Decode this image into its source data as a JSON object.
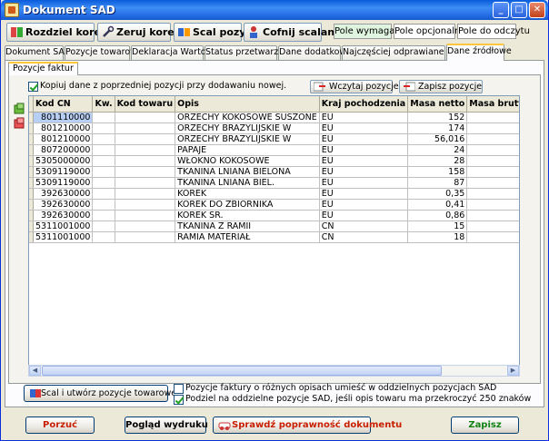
{
  "window": {
    "title": "Dokument SAD"
  },
  "toolbar": {
    "buttons": [
      {
        "label": "Rozdziel korektę",
        "icon": "split-icon"
      },
      {
        "label": "Zeruj korekty",
        "icon": "wrench-icon"
      },
      {
        "label": "Scal pozycje",
        "icon": "merge-icon"
      },
      {
        "label": "Cofnij scalanie",
        "icon": "undo-merge-icon"
      }
    ],
    "legend": {
      "required": "Pole wymagane",
      "optional": "Pole opcjonalne",
      "readonly": "Pole do odczytu"
    }
  },
  "colors": {
    "required": "#dff5df",
    "optional": "#ffffff",
    "readonly": "#ffffff",
    "accent": "#ffc83c"
  },
  "tabs": [
    {
      "label": "Dokument SAD"
    },
    {
      "label": "Pozycje towarowe"
    },
    {
      "label": "Deklaracja Wartości"
    },
    {
      "label": "Status przetwarzania"
    },
    {
      "label": "Dane dodatkowe"
    },
    {
      "label": "Najczęściej odprawiane towary"
    },
    {
      "label": "Dane źródłowe"
    }
  ],
  "subtab": {
    "label": "Pozycje faktur"
  },
  "copy_checkbox": {
    "label": "Kopiuj dane z poprzedniej pozycji przy dodawaniu nowej.",
    "checked": true
  },
  "actions": {
    "load": "Wczytaj pozycje",
    "save": "Zapisz pozycje"
  },
  "grid": {
    "columns": [
      "Kod CN",
      "Kw.",
      "Kod towaru",
      "Opis",
      "Kraj pochodzenia",
      "Masa netto",
      "Masa brutto"
    ],
    "rows": [
      [
        "801110000",
        "",
        "",
        "ORZECHY KOKOSOWE SUSZONE",
        "EU",
        "152",
        ""
      ],
      [
        "801210000",
        "",
        "",
        "ORZECHY BRAZYLIJSKIE W",
        "EU",
        "174",
        ""
      ],
      [
        "801210000",
        "",
        "",
        "ORZECHY BRAZYLIJSKIE W",
        "EU",
        "56,016",
        ""
      ],
      [
        "807200000",
        "",
        "",
        "PAPAJE",
        "EU",
        "24",
        ""
      ],
      [
        "5305000000",
        "",
        "",
        "WŁÓKNO KOKOSOWE",
        "EU",
        "28",
        ""
      ],
      [
        "5309119000",
        "",
        "",
        "TKANINA LNIANA BIELONA",
        "EU",
        "158",
        ""
      ],
      [
        "5309119000",
        "",
        "",
        "TKANINA LNIANA BIEL.",
        "EU",
        "87",
        ""
      ],
      [
        "392630000",
        "",
        "",
        "KOREK",
        "EU",
        "0,35",
        ""
      ],
      [
        "392630000",
        "",
        "",
        "KOREK DO ZBIORNIKA",
        "EU",
        "0,41",
        ""
      ],
      [
        "392630000",
        "",
        "",
        "KOREK ŚR.",
        "EU",
        "0,86",
        ""
      ],
      [
        "5311001000",
        "",
        "",
        "TKANINA Z RAMII",
        "CN",
        "15",
        ""
      ],
      [
        "5311001000",
        "",
        "",
        "RAMIA MATERIAŁ",
        "CN",
        "18",
        ""
      ]
    ]
  },
  "bottom": {
    "merge_button": "Scal i utwórz pozycje towarowe",
    "option1": {
      "label": "Pozycje faktury o różnych opisach umieść w oddzielnych pozycjach SAD",
      "checked": false
    },
    "option2": {
      "label": "Podziel na oddzielne pozycje SAD, jeśli opis towaru ma przekroczyć 250 znaków",
      "checked": true
    }
  },
  "footer": {
    "cancel": "Porzuć",
    "preview": "Pogląd wydruku",
    "validate": "Sprawdź poprawność dokumentu",
    "save": "Zapisz"
  }
}
